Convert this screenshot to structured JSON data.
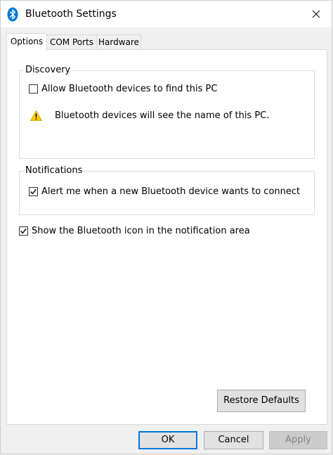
{
  "window": {
    "title": "Bluetooth Settings",
    "accent_color": "#0078d7",
    "icons": {
      "app": "bluetooth-icon",
      "close": "close-icon",
      "warning": "warning-icon",
      "check": "checkmark-icon"
    }
  },
  "tabs": [
    {
      "label": "Options",
      "selected": true
    },
    {
      "label": "COM Ports",
      "selected": false
    },
    {
      "label": "Hardware",
      "selected": false
    }
  ],
  "discovery": {
    "legend": "Discovery",
    "allow_find_label": "Allow Bluetooth devices to find this PC",
    "allow_find_checked": false,
    "warning_text": "Bluetooth devices will see the name of this PC."
  },
  "notifications": {
    "legend": "Notifications",
    "alert_label": "Alert me when a new Bluetooth device wants to connect",
    "alert_checked": true
  },
  "show_icon": {
    "label": "Show the Bluetooth icon in the notification area",
    "checked": true
  },
  "buttons": {
    "restore_defaults": "Restore Defaults",
    "ok": "OK",
    "cancel": "Cancel",
    "apply": "Apply",
    "apply_enabled": false
  }
}
